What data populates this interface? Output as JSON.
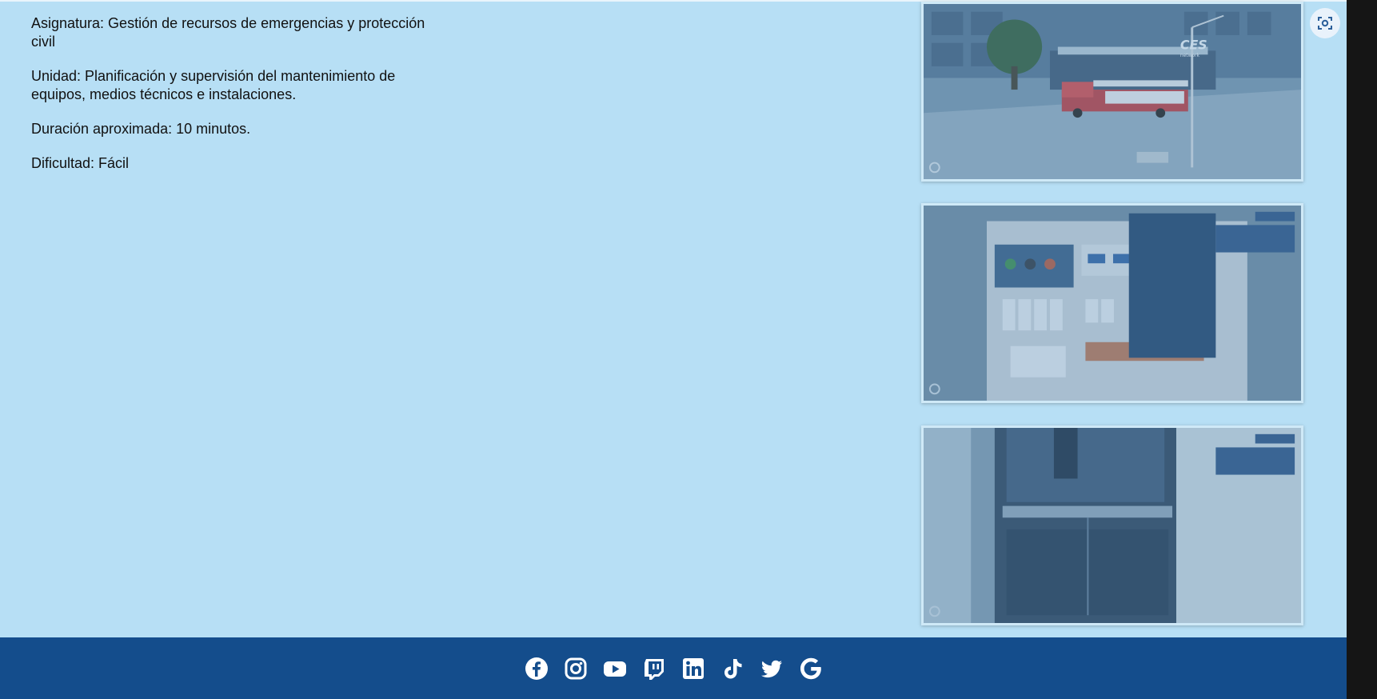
{
  "info": {
    "asignatura": "Asignatura: Gestión de recursos de emergencias y protección civil",
    "unidad": "Unidad: Planificación y supervisión del mantenimiento de equipos, medios técnicos e instalaciones.",
    "duracion": "Duración aproximada: 10 minutos.",
    "dificultad": "Dificultad: Fácil"
  },
  "screenshots": {
    "logo_text": "CES",
    "logo_subtext": "network"
  },
  "footer": {
    "social_icons": [
      "facebook-icon",
      "instagram-icon",
      "youtube-icon",
      "twitch-icon",
      "linkedin-icon",
      "tiktok-icon",
      "twitter-icon",
      "google-icon"
    ]
  },
  "colors": {
    "page_background": "#b7dff5",
    "footer_background": "#144d8c",
    "side_strip": "#151515"
  }
}
